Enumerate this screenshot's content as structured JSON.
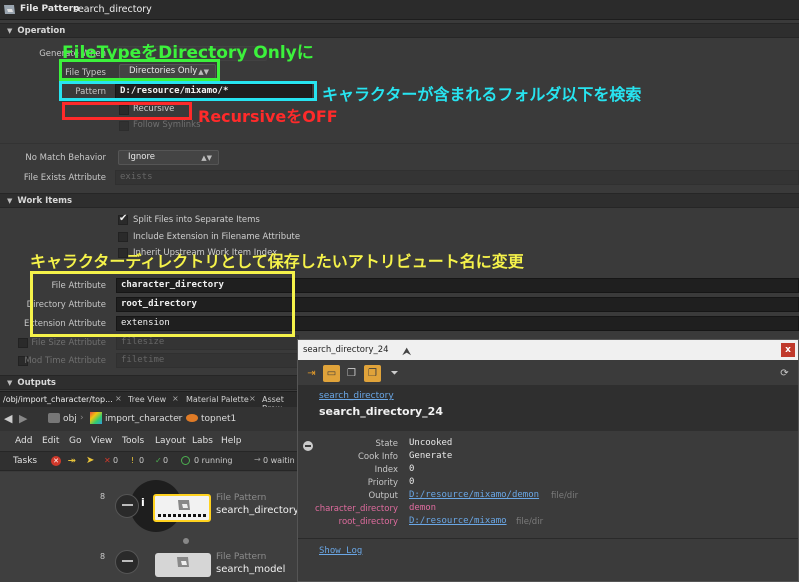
{
  "titlebar": {
    "node_type": "File Pattern",
    "node_name": "search_directory"
  },
  "operation": {
    "section": "Operation",
    "generate_label": "Generate When",
    "file_types_label": "File Types",
    "file_types_value": "Directories Only",
    "pattern_label": "Pattern",
    "pattern_value": "D:/resource/mixamo/*",
    "recursive_label": "Recursive",
    "follow_symlinks_label": "Follow Symlinks",
    "no_match_label": "No Match Behavior",
    "no_match_value": "Ignore",
    "file_exists_label": "File Exists Attribute",
    "file_exists_value": "exists"
  },
  "work_items": {
    "section": "Work Items",
    "split_label": "Split Files into Separate Items",
    "include_ext_label": "Include Extension in Filename Attribute",
    "inherit_label": "Inherit Upstream Work Item Index",
    "file_attr_label": "File Attribute",
    "file_attr_value": "character_directory",
    "dir_attr_label": "Directory Attribute",
    "dir_attr_value": "root_directory",
    "ext_attr_label": "Extension Attribute",
    "ext_attr_value": "extension",
    "size_attr_label": "File Size Attribute",
    "size_attr_value": "filesize",
    "mtime_attr_label": "Mod Time Attribute",
    "mtime_attr_value": "filetime"
  },
  "outputs": {
    "section": "Outputs"
  },
  "annotations": {
    "green": "FileTypeをDirectory Onlyに",
    "cyan": "キャラクターが含まれるフォルダ以下を検索",
    "red": "RecursiveをOFF",
    "yellow": "キャラクターディレクトリとして保存したいアトリビュート名に変更"
  },
  "tabs": {
    "path_tab": "/obj/import_character/top...",
    "tree_view": "Tree View",
    "material_palette": "Material Palette",
    "asset_browser": "Asset Brow"
  },
  "nav": {
    "obj": "obj",
    "import_character": "import_character",
    "topnet": "topnet1"
  },
  "menu": {
    "add": "Add",
    "edit": "Edit",
    "go": "Go",
    "view": "View",
    "tools": "Tools",
    "layout": "Layout",
    "labs": "Labs",
    "help": "Help"
  },
  "tasks": {
    "label": "Tasks",
    "error_count": "0",
    "warn_count": "0",
    "ok_count": "0",
    "running": "0 running",
    "waiting": "0 waitin"
  },
  "network": {
    "node1_type": "File Pattern",
    "node1_name": "search_directory",
    "node2_type": "File Pattern",
    "node2_name": "search_model",
    "num1": "8",
    "num2": "8"
  },
  "popup": {
    "title": "search_directory_24",
    "link": "search_directory",
    "heading": "search_directory_24",
    "state_label": "State",
    "state_value": "Uncooked",
    "cookinfo_label": "Cook Info",
    "cookinfo_value": "Generate",
    "index_label": "Index",
    "index_value": "0",
    "priority_label": "Priority",
    "priority_value": "0",
    "output_label": "Output",
    "output_value": "D:/resource/mixamo/demon",
    "output_tag": "file/dir",
    "chardir_label": "character_directory",
    "chardir_value": "demon",
    "rootdir_label": "root_directory",
    "rootdir_value": "D:/resource/mixamo",
    "rootdir_tag": "file/dir",
    "show_log": "Show Log"
  },
  "colors": {
    "green": "#3cf23c",
    "cyan": "#27e4f0",
    "red": "#ff2a2a",
    "yellow": "#f5f24a",
    "pink": "#e06c9f"
  }
}
